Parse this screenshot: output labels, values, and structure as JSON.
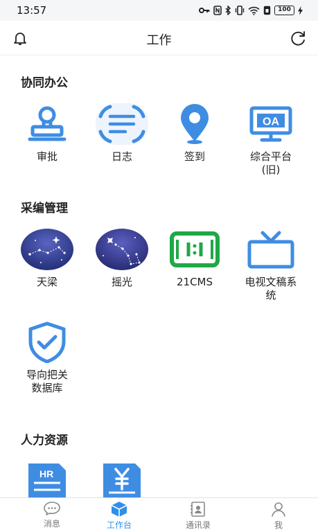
{
  "status_bar": {
    "time": "13:57",
    "battery": "100"
  },
  "header": {
    "title": "工作"
  },
  "sections": [
    {
      "title": "协同办公",
      "items": [
        {
          "label": "审批",
          "icon": "stamp-icon"
        },
        {
          "label": "日志",
          "icon": "log-icon"
        },
        {
          "label": "签到",
          "icon": "location-pin-icon"
        },
        {
          "label": "综合平台(旧)",
          "icon": "oa-monitor-icon"
        }
      ]
    },
    {
      "title": "采编管理",
      "items": [
        {
          "label": "天梁",
          "icon": "star-globe-icon"
        },
        {
          "label": "摇光",
          "icon": "big-dipper-icon"
        },
        {
          "label": "21CMS",
          "icon": "cms-frame-icon"
        },
        {
          "label": "电视文稿系统",
          "icon": "tv-icon"
        },
        {
          "label": "导向把关数据库",
          "icon": "shield-check-icon"
        }
      ]
    },
    {
      "title": "人力资源",
      "items": [
        {
          "label": "",
          "icon": "hr-document-icon"
        },
        {
          "label": "",
          "icon": "yen-document-icon"
        }
      ]
    }
  ],
  "tabbar": {
    "tabs": [
      {
        "label": "消息",
        "icon": "chat-bubble-icon",
        "active": false
      },
      {
        "label": "工作台",
        "icon": "cube-icon",
        "active": true
      },
      {
        "label": "通讯录",
        "icon": "contacts-book-icon",
        "active": false
      },
      {
        "label": "我",
        "icon": "person-icon",
        "active": false
      }
    ]
  },
  "colors": {
    "accent": "#2f8fe8",
    "icon_blue": "#3f8de3",
    "cms_green": "#1fa846",
    "star_bg": "#2b3a86"
  }
}
